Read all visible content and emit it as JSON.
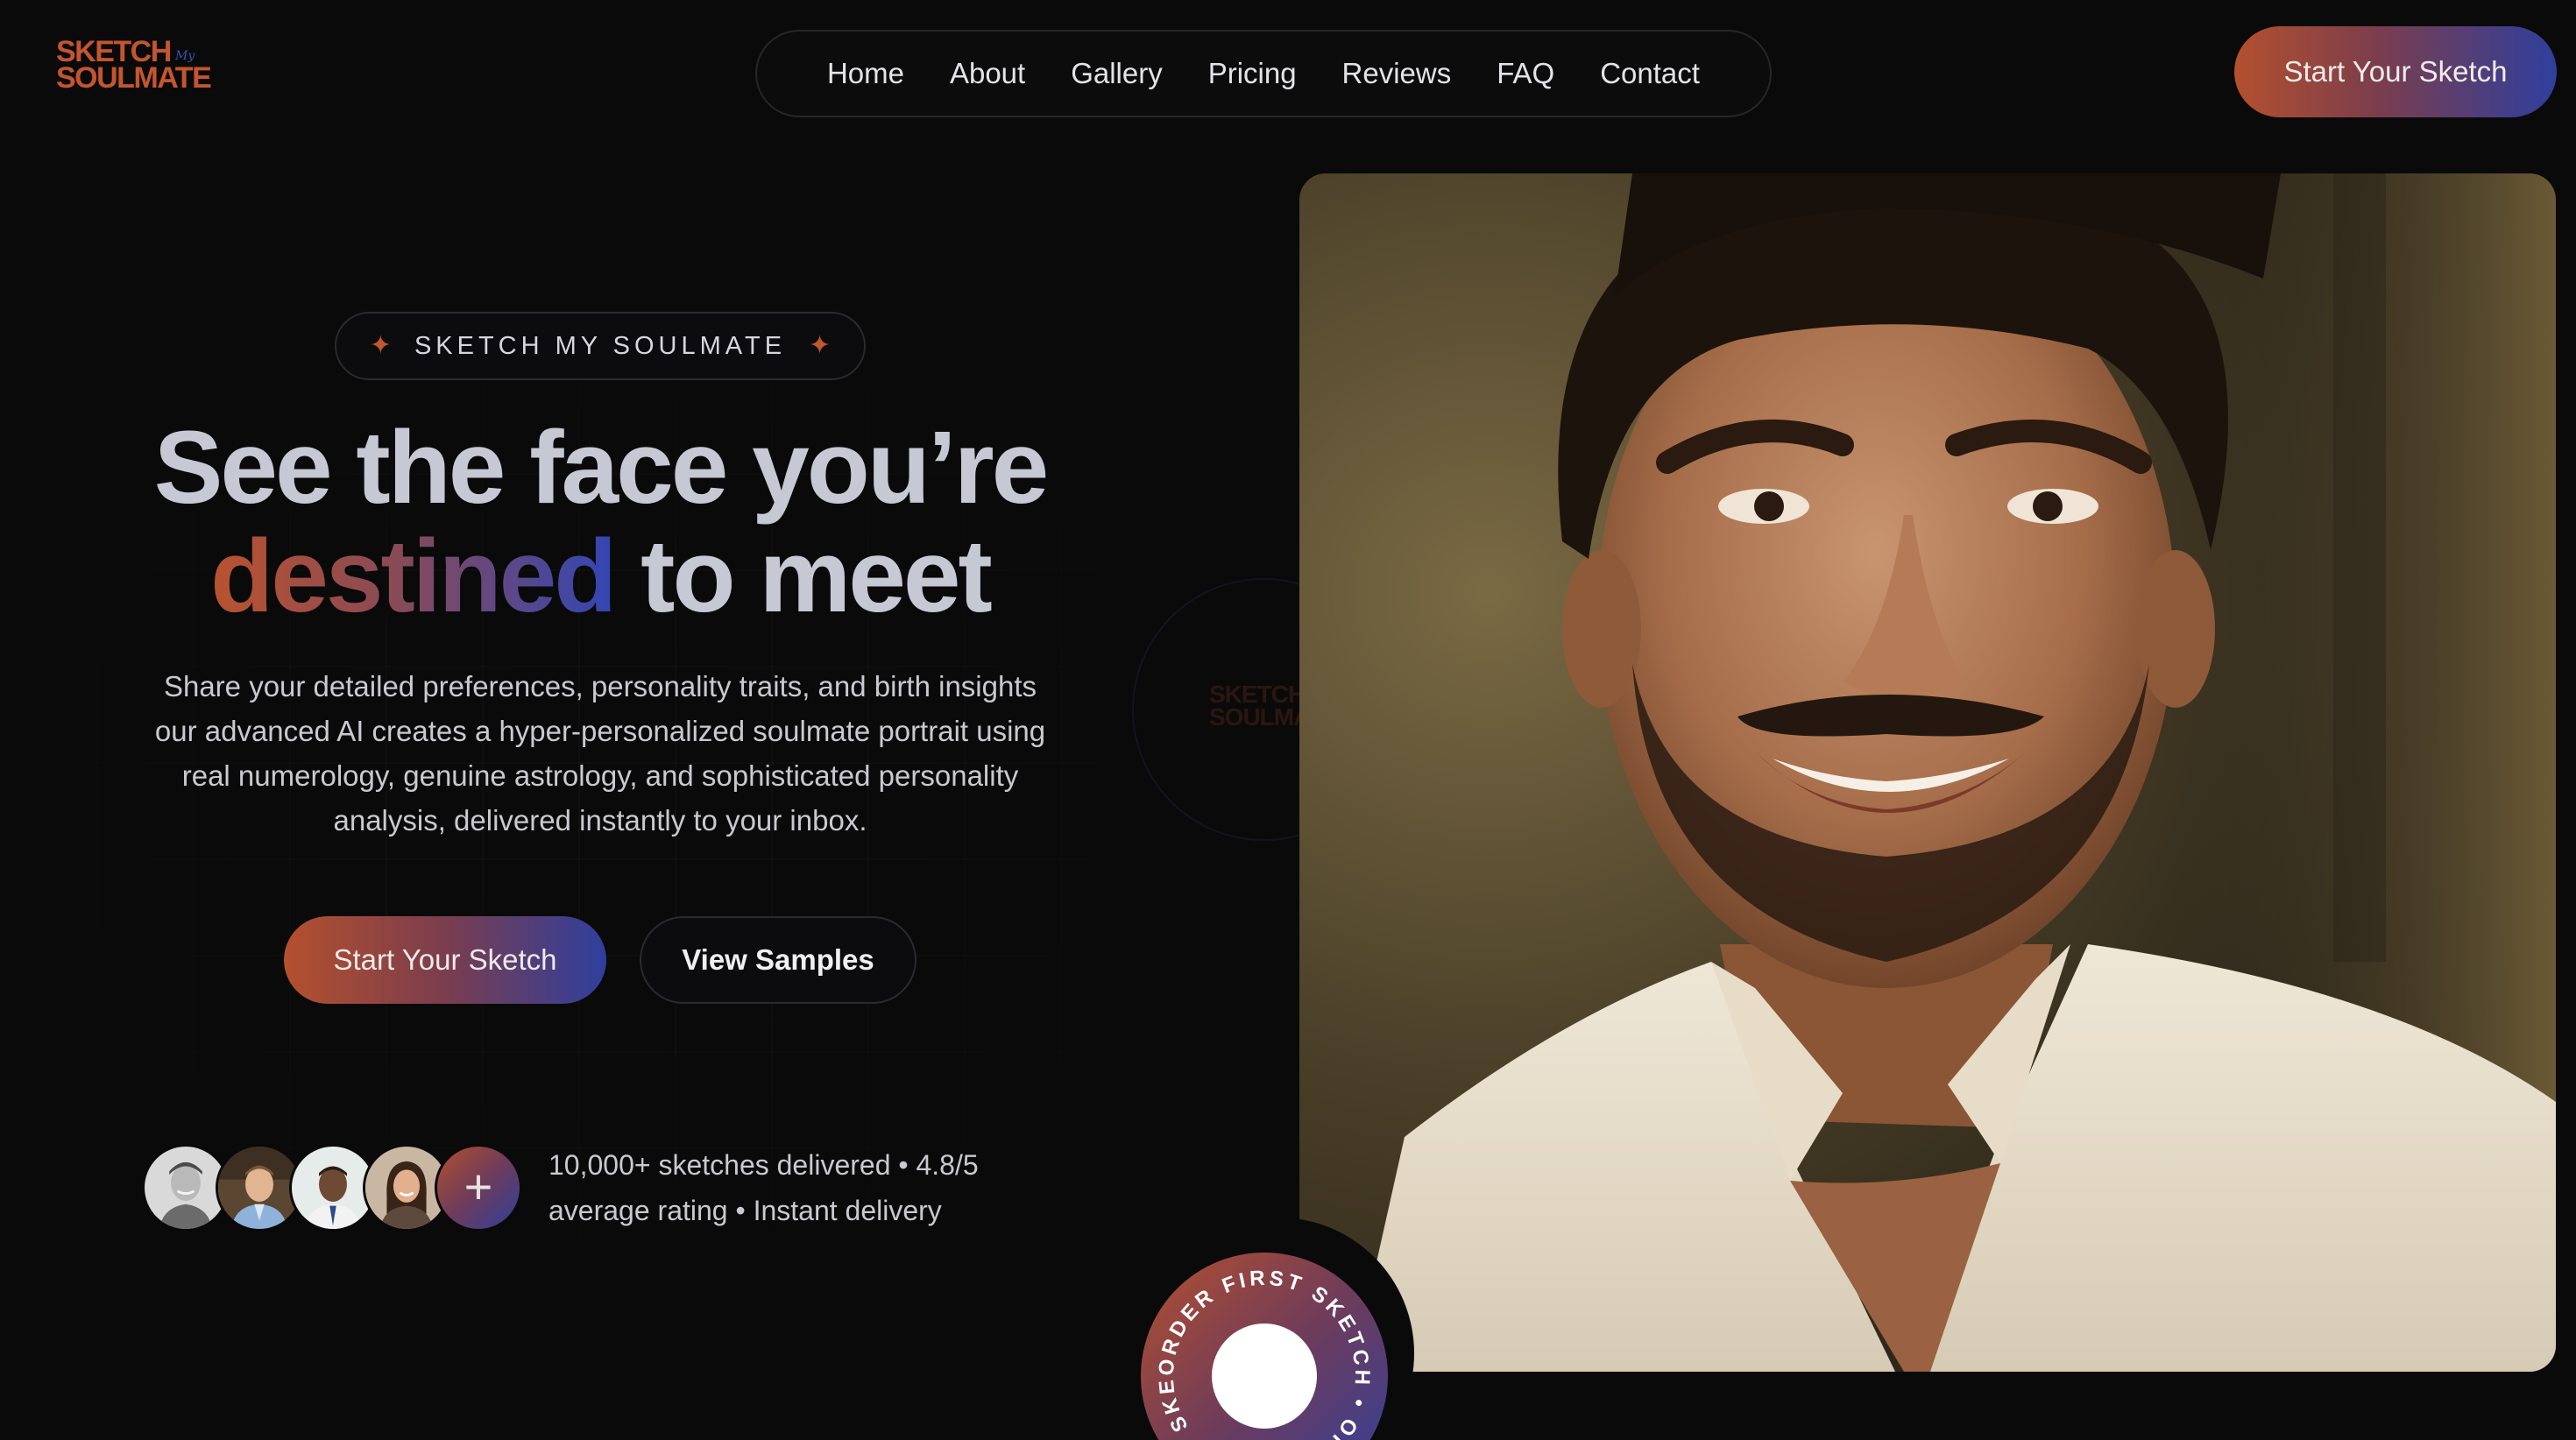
{
  "brand": {
    "logo_line1": "SKETCH",
    "logo_my": "My",
    "logo_line2": "SOULMATE",
    "accent": "#c3552f",
    "accent_blue": "#3346b4"
  },
  "nav": {
    "items": [
      {
        "label": "Home"
      },
      {
        "label": "About"
      },
      {
        "label": "Gallery"
      },
      {
        "label": "Pricing"
      },
      {
        "label": "Reviews"
      },
      {
        "label": "FAQ"
      },
      {
        "label": "Contact"
      }
    ],
    "cta_label": "Start Your Sketch"
  },
  "hero": {
    "badge_label": "SKETCH MY SOULMATE",
    "badge_icon": "sparkle-icon",
    "headline_line1": "See the face you’re",
    "headline_highlight": "destined",
    "headline_rest": "to meet",
    "subtext": "Share your detailed preferences, personality traits, and birth insights our advanced AI creates a hyper-personalized soulmate portrait using real numerology, genuine astrology, and sophisticated personality analysis, delivered instantly to your inbox.",
    "primary_button": "Start Your Sketch",
    "secondary_button": "View Samples",
    "social_proof_line1": "10,000+ sketches delivered • 4.8/5",
    "social_proof_line2": "average rating • Instant delivery",
    "avatar_plus": "+",
    "avatar_icons": [
      "avatar-man-1",
      "avatar-man-2",
      "avatar-man-3",
      "avatar-woman-1"
    ]
  },
  "watermark": {
    "line1": "SKETCH",
    "line2": "SOULMA"
  },
  "ring_badge": {
    "text": "ORDER FIRST SKETCH • ORDER FIRST SKETCH • "
  }
}
